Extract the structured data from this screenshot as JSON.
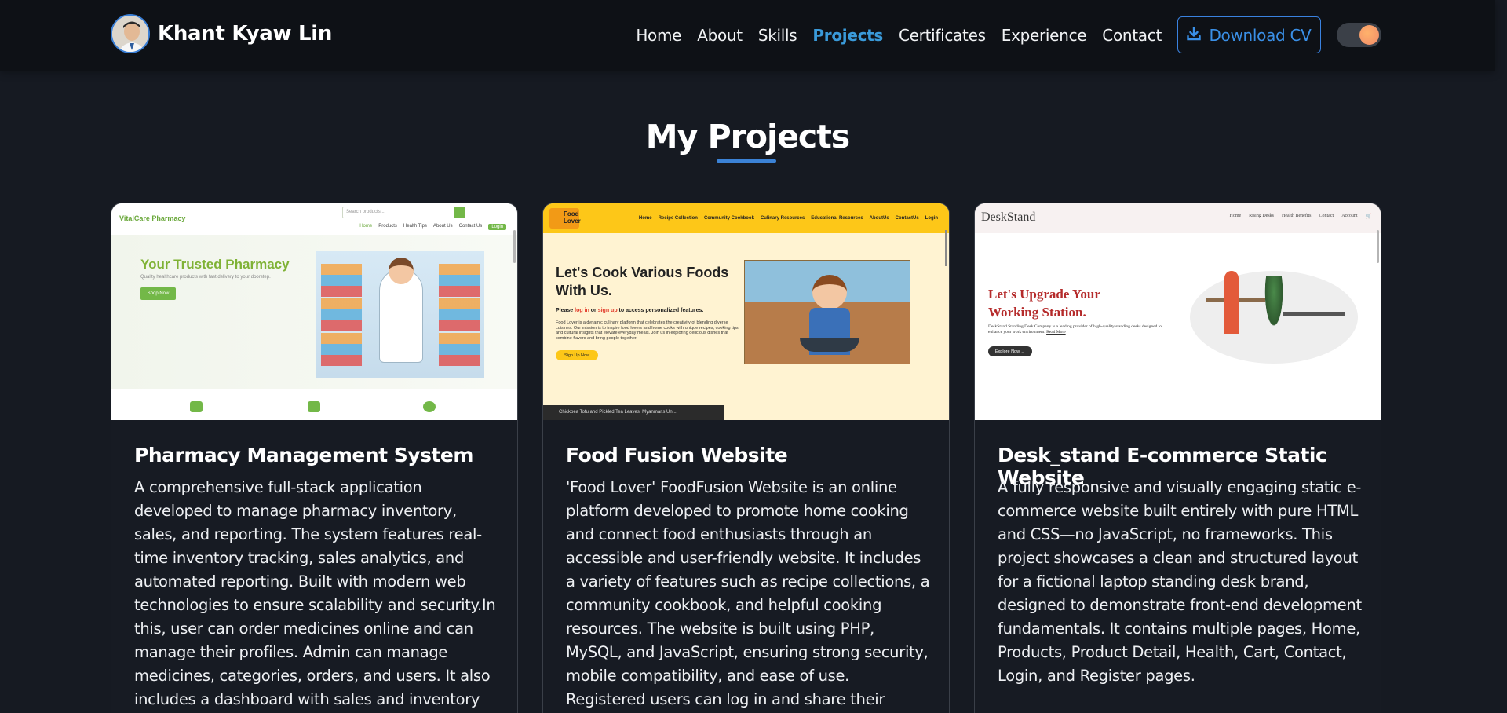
{
  "header": {
    "brand_name": "Khant Kyaw Lin",
    "nav": [
      {
        "label": "Home",
        "active": false
      },
      {
        "label": "About",
        "active": false
      },
      {
        "label": "Skills",
        "active": false
      },
      {
        "label": "Projects",
        "active": true
      },
      {
        "label": "Certificates",
        "active": false
      },
      {
        "label": "Experience",
        "active": false
      },
      {
        "label": "Contact",
        "active": false
      }
    ],
    "download_cv_label": "Download CV",
    "download_icon": "download-icon",
    "theme_toggle_icon": "theme-toggle"
  },
  "section": {
    "title": "My Projects",
    "accent_color": "#3b82d6"
  },
  "projects": [
    {
      "title": "Pharmacy Management System",
      "description": "A comprehensive full-stack application developed to manage pharmacy inventory, sales, and reporting. The system features real-time inventory tracking, sales analytics, and automated reporting. Built with modern web technologies to ensure scalability and security.In this, user can order medicines online and can manage their profiles. Admin can manage medicines, categories, orders, and users. It also includes a dashboard with sales and inventory analytics.",
      "screenshot": {
        "logo": "VitalCare Pharmacy",
        "search_placeholder": "Search products...",
        "menu": [
          "Home",
          "Products",
          "Health Tips",
          "About Us",
          "Contact Us",
          "Login"
        ],
        "headline": "Your Trusted Pharmacy",
        "subline": "Quality healthcare products with fast delivery to your doorstep.",
        "cta": "Shop Now"
      }
    },
    {
      "title": "Food Fusion Website",
      "description": "'Food Lover' FoodFusion Website is an online platform developed to promote home cooking and connect food enthusiasts through an accessible and user-friendly website. It includes a variety of features such as recipe collections, a community cookbook, and helpful cooking resources. The website is built using PHP, MySQL, and JavaScript, ensuring strong security, mobile compatibility, and ease of use. Registered users can log in and share their culinary experiences, contributing to an",
      "screenshot": {
        "logo": "Food Lover",
        "menu": [
          "Home",
          "Recipe Collection",
          "Community Cookbook",
          "Culinary Resources",
          "Educational Resources",
          "AboutUs",
          "ContactUs",
          "Login"
        ],
        "headline": "Let's Cook Various Foods With Us.",
        "login_line_pre": "Please ",
        "login_word": "log in",
        "login_mid": " or ",
        "signup_word": "sign up",
        "login_line_post": " to access personalized features.",
        "body": "Food Lover is a dynamic culinary platform that celebrates the creativity of blending diverse cuisines. Our mission is to inspire food lovers and home cooks with unique recipes, cooking tips, and cultural insights that elevate everyday meals. Join us in exploring delicious dishes that combine flavors and bring people together.",
        "cta": "Sign Up Now",
        "video_caption": "Chickpea Tofu and Pickled Tea Leaves: Myanmar's Un..."
      }
    },
    {
      "title": "Desk_stand E-commerce Static Website",
      "description": "A fully responsive and visually engaging static e-commerce website built entirely with pure HTML and CSS—no JavaScript, no frameworks. This project showcases a clean and structured layout for a fictional laptop standing desk brand, designed to demonstrate front-end development fundamentals. It contains multiple pages, Home, Products, Product Detail, Health, Cart, Contact, Login, and Register pages.",
      "screenshot": {
        "logo": "DeskStand",
        "menu": [
          "Home",
          "Rising Desks",
          "Health Benefits",
          "Contact",
          "Account"
        ],
        "headline": "Let's Upgrade Your Working Station.",
        "body": "DeskStand Standing Desk Company is a leading provider of high-quality standing desks designed to enhance your work environment.",
        "read_more": "Read More",
        "cta": "Explore Now →"
      }
    }
  ]
}
